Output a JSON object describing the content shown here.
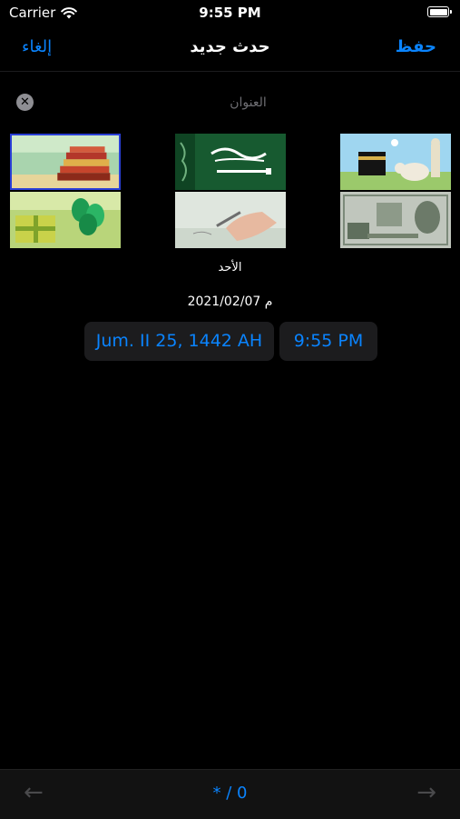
{
  "status": {
    "carrier": "Carrier",
    "time": "9:55 PM"
  },
  "nav": {
    "cancel": "إلغاء",
    "title": "حدث جديد",
    "save": "حفظ"
  },
  "title_field": {
    "placeholder": "العنوان",
    "value": ""
  },
  "images": [
    {
      "name": "books",
      "selected": true
    },
    {
      "name": "saudi-flag",
      "selected": false
    },
    {
      "name": "kaaba-cartoon",
      "selected": false
    },
    {
      "name": "gift-balloons",
      "selected": false
    },
    {
      "name": "hand-writing",
      "selected": false
    },
    {
      "name": "saudi-banknote",
      "selected": false
    }
  ],
  "day": "الأحد",
  "date_text": "2021/02/07 م",
  "hijri_date": "Jum. II 25, 1442 AH",
  "time_value": "9:55 PM",
  "toolbar": {
    "counter": "* / 0"
  },
  "colors": {
    "accent": "#0a84ff",
    "background": "#000000",
    "pill": "#1c1c1e",
    "selection": "#2a3fd6"
  }
}
